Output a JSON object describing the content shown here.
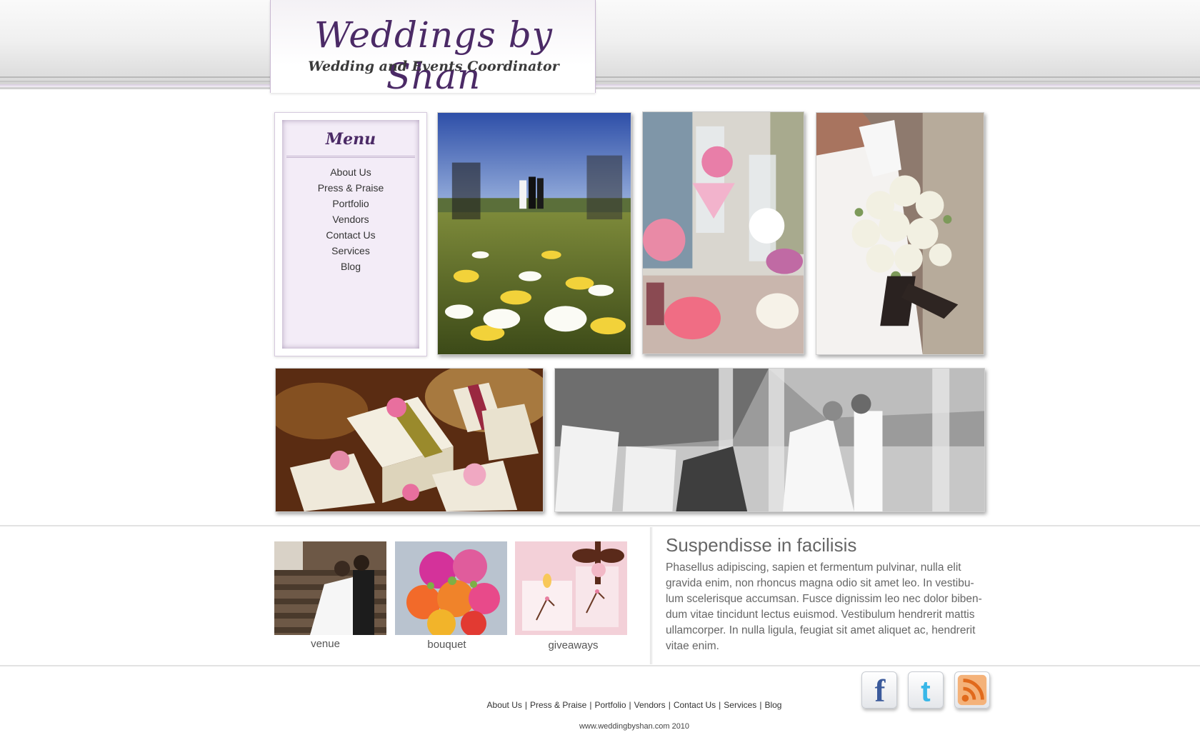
{
  "header": {
    "title": "Weddings by Shan",
    "subtitle": "Wedding and Events Coordinator"
  },
  "menu": {
    "title": "Menu",
    "items": [
      {
        "label": "About Us"
      },
      {
        "label": "Press & Praise"
      },
      {
        "label": "Portfolio"
      },
      {
        "label": "Vendors"
      },
      {
        "label": "Contact Us"
      },
      {
        "label": "Services"
      },
      {
        "label": "Blog"
      }
    ]
  },
  "gallery": {
    "photos": [
      "aisle-flowers-photo",
      "candy-bar-photo",
      "bridal-bouquet-photo",
      "favor-boxes-photo",
      "beach-couple-photo"
    ]
  },
  "thumbs": [
    {
      "caption": "venue"
    },
    {
      "caption": "bouquet"
    },
    {
      "caption": "giveaways"
    }
  ],
  "article": {
    "title": "Suspendisse in facilisis",
    "body": "Phasellus adipiscing, sapien et fermentum pulvinar, nulla elit gravida enim, non rhoncus magna odio sit amet leo. In vestibu-lum scelerisque accumsan. Fusce dignissim leo nec dolor biben-dum vitae tincidunt lectus euismod. Vestibulum hendrerit mattis ullamcorper. In nulla ligula, feugiat sit amet aliquet ac, hendrerit vitae enim."
  },
  "footer": {
    "nav": [
      "About Us",
      "Press & Praise",
      "Portfolio",
      "Vendors",
      "Contact Us",
      "Services",
      "Blog"
    ],
    "separator": "|",
    "copyright": "www.weddingbyshan.com 2010"
  },
  "social": [
    "facebook-icon",
    "twitter-icon",
    "rss-icon"
  ],
  "colors": {
    "brand_purple": "#4b2a66",
    "menu_bg": "#f3ecf7",
    "text_gray": "#666666"
  }
}
